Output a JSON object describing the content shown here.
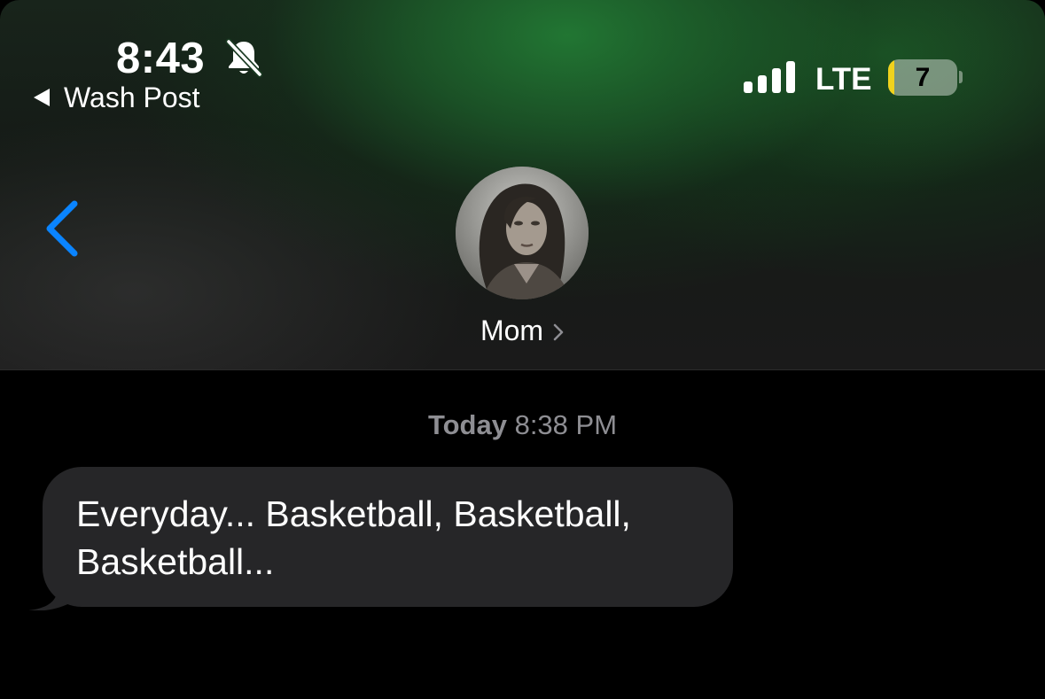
{
  "status_bar": {
    "time": "8:43",
    "back_app": "Wash Post",
    "network": "LTE",
    "battery_level": "7",
    "battery_fraction": 0.07,
    "signal_bars": 4,
    "icons": [
      "bell-slash-icon",
      "cellular-signal-icon",
      "battery-icon"
    ]
  },
  "conversation": {
    "contact_name": "Mom",
    "back_icon": "chevron-left-icon",
    "detail_icon": "chevron-right-icon"
  },
  "messages": {
    "timestamp_day": "Today",
    "timestamp_time": "8:38 PM",
    "items": [
      {
        "direction": "incoming",
        "text": "Everyday... Basketball, Basketball, Basketball..."
      }
    ]
  },
  "colors": {
    "accent": "#0a84ff",
    "incoming_bubble": "#262628",
    "timestamp": "#8e8e93",
    "header_tint": "#1c6a2e",
    "battery_low": "#f0d21d"
  }
}
